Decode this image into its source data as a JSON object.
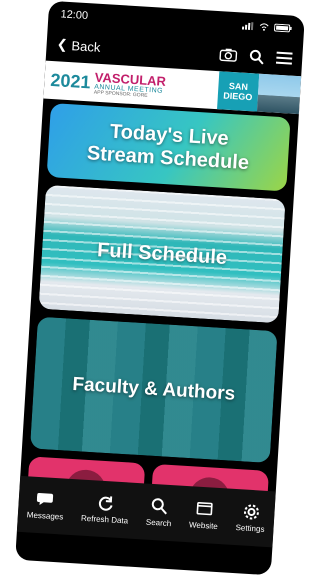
{
  "status": {
    "time": "12:00"
  },
  "nav": {
    "back_label": "Back"
  },
  "banner": {
    "year": "2021",
    "title": "VASCULAR",
    "subtitle": "ANNUAL MEETING",
    "sponsor": "APP SPONSOR: GORE",
    "city_line1": "SAN",
    "city_line2": "DIEGO"
  },
  "tiles": {
    "live_line1": "Today's Live",
    "live_line2": "Stream Schedule",
    "full": "Full Schedule",
    "faculty": "Faculty & Authors"
  },
  "tabs": [
    {
      "label": "Messages",
      "icon": "messages-icon"
    },
    {
      "label": "Refresh Data",
      "icon": "refresh-icon"
    },
    {
      "label": "Search",
      "icon": "search-icon"
    },
    {
      "label": "Website",
      "icon": "website-icon"
    },
    {
      "label": "Settings",
      "icon": "settings-icon"
    }
  ]
}
